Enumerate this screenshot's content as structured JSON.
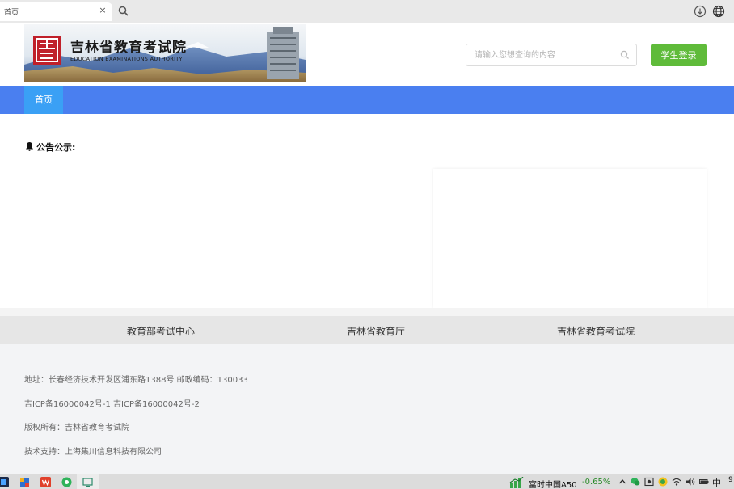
{
  "browser": {
    "tab_title": "首页",
    "close_glyph": "×",
    "icons": [
      "search-icon",
      "download-icon",
      "globe-icon"
    ]
  },
  "header": {
    "logo_title": "吉林省教育考试院",
    "logo_subtitle": "EDUCATION EXAMINATIONS AUTHORITY",
    "search_placeholder": "请输入您想查询的内容",
    "login_label": "学生登录",
    "colors": {
      "login": "#5fbb3a",
      "logo_red": "#c0202a"
    }
  },
  "nav": {
    "items": [
      {
        "label": "首页",
        "active": true
      }
    ],
    "colors": {
      "bar": "#4a7ff0",
      "active": "#3aa0f5"
    }
  },
  "notice": {
    "label": "公告公示:"
  },
  "footer": {
    "links": [
      "教育部考试中心",
      "吉林省教育厅",
      "吉林省教育考试院"
    ],
    "lines": [
      "地址：长春经济技术开发区浦东路1388号    邮政编码：130033",
      "吉ICP备16000042号-1 吉ICP备16000042号-2",
      "版权所有：吉林省教育考试院",
      "技术支持：上海集川信息科技有限公司"
    ]
  },
  "taskbar": {
    "stock_name": "富时中国A50",
    "stock_change": "-0.65%",
    "tray_ime": "中",
    "tray_clock_fragment": "9"
  }
}
